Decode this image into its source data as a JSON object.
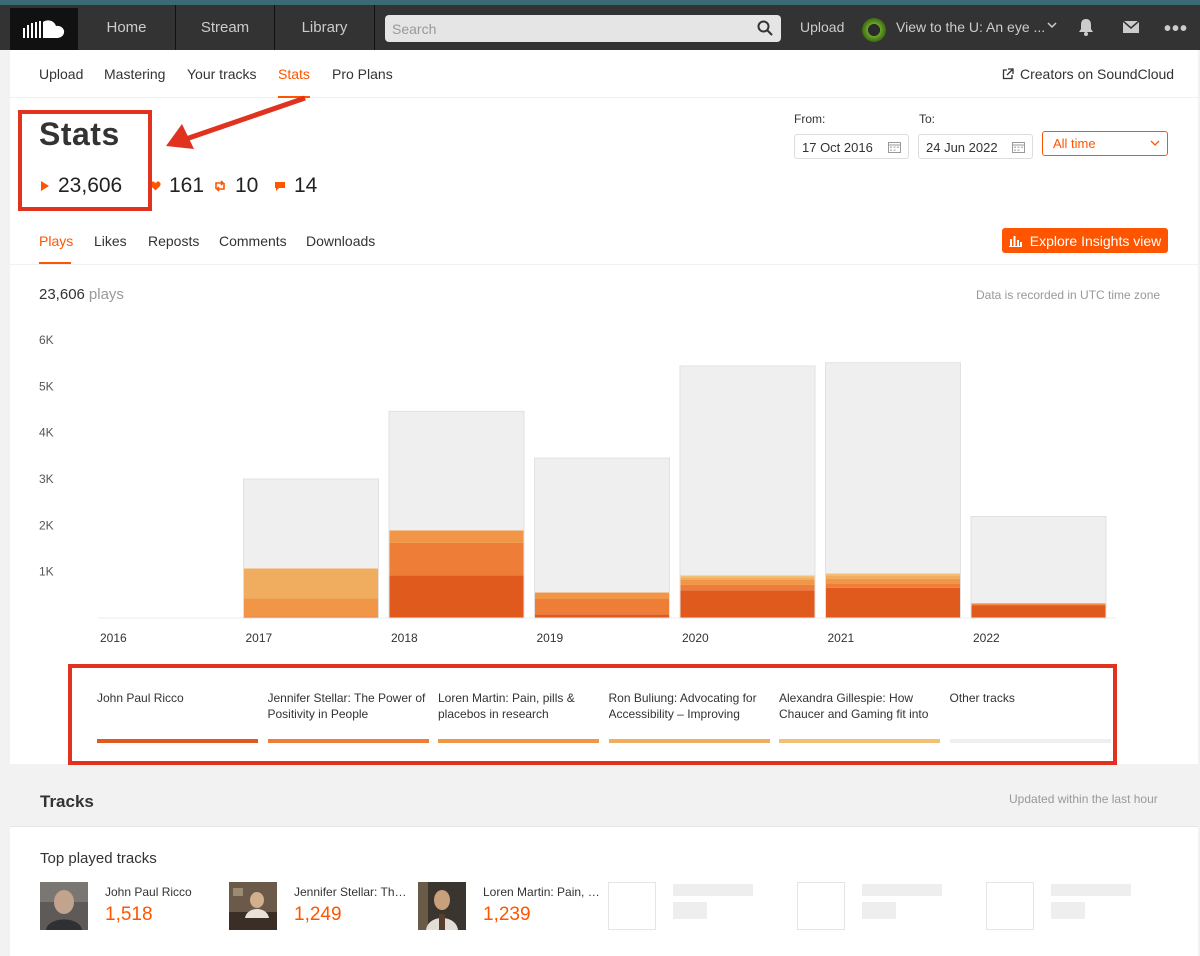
{
  "topbar": {
    "nav": [
      "Home",
      "Stream",
      "Library"
    ],
    "search_placeholder": "Search",
    "upload": "Upload",
    "user_name": "View to the U: An eye ...",
    "more": "•••"
  },
  "subnav": {
    "items": [
      "Upload",
      "Mastering",
      "Your tracks",
      "Stats",
      "Pro Plans"
    ],
    "active": "Stats",
    "creators_link": "Creators on SoundCloud"
  },
  "stats": {
    "title": "Stats",
    "plays": "23,606",
    "likes": "161",
    "reposts": "10",
    "comments": "14"
  },
  "dates": {
    "from_label": "From:",
    "from_value": "17 Oct 2016",
    "to_label": "To:",
    "to_value": "24 Jun 2022",
    "period": "All time"
  },
  "metric_tabs": {
    "items": [
      "Plays",
      "Likes",
      "Reposts",
      "Comments",
      "Downloads"
    ],
    "active": "Plays",
    "explore_button": "Explore Insights view"
  },
  "summary": {
    "total": "23,606",
    "unit": "plays",
    "utc_note": "Data is recorded in UTC time zone"
  },
  "chart_data": {
    "type": "bar",
    "stacked": true,
    "categories": [
      "2016",
      "2017",
      "2018",
      "2019",
      "2020",
      "2021",
      "2022"
    ],
    "y_tick_labels": [
      "1K",
      "2K",
      "3K",
      "4K",
      "5K",
      "6K"
    ],
    "ylim": [
      0,
      6000
    ],
    "series": [
      {
        "name": "John Paul Ricco",
        "color": "#e05a1e",
        "values": [
          0,
          20,
          920,
          80,
          600,
          650,
          270
        ]
      },
      {
        "name": "Jennifer Stellar: The Power of Positivity in People",
        "color": "#ee7d37",
        "values": [
          0,
          20,
          700,
          330,
          120,
          100,
          30
        ]
      },
      {
        "name": "Loren Martin: Pain, pills & placebos in research",
        "color": "#f09646",
        "values": [
          0,
          380,
          270,
          140,
          100,
          100,
          20
        ]
      },
      {
        "name": "Ron Buliung: Advocating for Accessibility – Improving",
        "color": "#f0ad60",
        "values": [
          0,
          650,
          0,
          0,
          60,
          70,
          0
        ]
      },
      {
        "name": "Alexandra Gillespie: How Chaucer and Gaming fit into",
        "color": "#f3bf74",
        "values": [
          0,
          0,
          0,
          0,
          40,
          40,
          0
        ]
      },
      {
        "name": "Other tracks",
        "color": "#efefef",
        "values": [
          0,
          1930,
          2570,
          2900,
          4520,
          4550,
          1870
        ]
      }
    ]
  },
  "legend_colors": [
    "#e05a1e",
    "#ee7d37",
    "#f09646",
    "#f0ad60",
    "#f3bf74",
    "#efefef"
  ],
  "tracks": {
    "title": "Tracks",
    "updated": "Updated within the last hour",
    "top_played_title": "Top played tracks",
    "items": [
      {
        "name": "John Paul Ricco",
        "plays": "1,518"
      },
      {
        "name": "Jennifer Stellar: The Power of Positivity in People",
        "plays": "1,249"
      },
      {
        "name": "Loren Martin: Pain, pills & placebos in research",
        "plays": "1,239"
      }
    ]
  }
}
